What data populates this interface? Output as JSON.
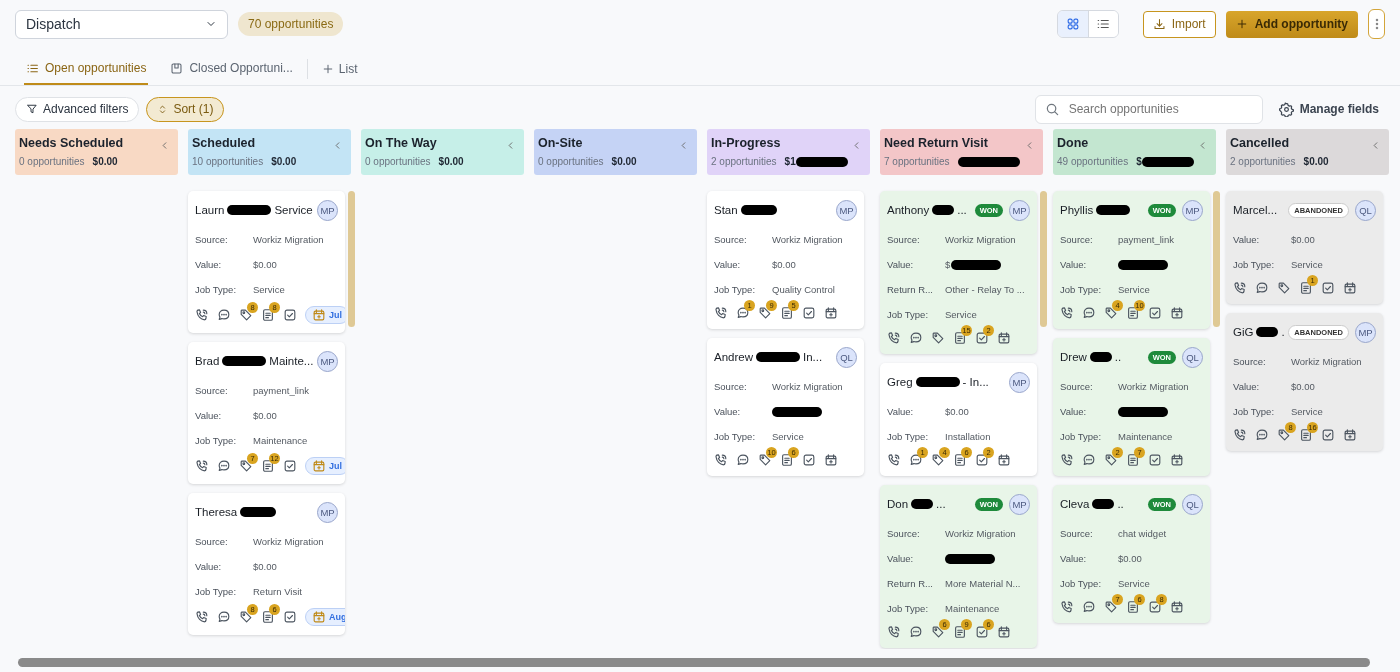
{
  "pipeline_select": {
    "value": "Dispatch"
  },
  "count_badge": "70 opportunities",
  "view_toggle": [
    {
      "kind": "grid",
      "selected": true
    },
    {
      "kind": "list",
      "selected": false
    }
  ],
  "import_button": "Import",
  "add_button": "Add opportunity",
  "tabs": [
    {
      "label": "Open opportunities",
      "kind": "list",
      "selected": true
    },
    {
      "label": "Closed Opportuni...",
      "kind": "board",
      "selected": false
    }
  ],
  "add_list": "List",
  "filters": {
    "advanced": "Advanced filters",
    "sort": "Sort (1)"
  },
  "search": {
    "placeholder": "Search opportunities"
  },
  "manage_fields": "Manage fields",
  "columns": [
    {
      "title": "Needs Scheduled",
      "count": "0 opportunities",
      "total": "$0.00",
      "color": "#f8d9c4"
    },
    {
      "title": "Scheduled",
      "count": "10 opportunities",
      "total": "$0.00",
      "color": "#c3e4f5",
      "cards": [
        {
          "name": "Laurn",
          "redacted": true,
          "name_end": "Service",
          "avatar": "MP",
          "fields": [
            {
              "label": "Source:",
              "value": "Workiz Migration"
            },
            {
              "label": "Value:",
              "value": "$0.00"
            },
            {
              "label": "Job Type:",
              "value": "Service"
            }
          ],
          "icons": [
            {
              "kind": "phone"
            },
            {
              "kind": "chat"
            },
            {
              "kind": "tag",
              "count": "8"
            },
            {
              "kind": "note",
              "count": "8"
            },
            {
              "kind": "task"
            }
          ],
          "date": "Jul"
        },
        {
          "name": "Brad",
          "redacted": true,
          "name_end": "Mainte...",
          "avatar": "MP",
          "fields": [
            {
              "label": "Source:",
              "value": "payment_link"
            },
            {
              "label": "Value:",
              "value": "$0.00"
            },
            {
              "label": "Job Type:",
              "value": "Maintenance"
            }
          ],
          "icons": [
            {
              "kind": "phone"
            },
            {
              "kind": "chat"
            },
            {
              "kind": "tag",
              "count": "7"
            },
            {
              "kind": "note",
              "count": "12"
            },
            {
              "kind": "task"
            }
          ],
          "date": "Jul"
        },
        {
          "name": "Theresa",
          "redacted": true,
          "avatar": "MP",
          "fields": [
            {
              "label": "Source:",
              "value": "Workiz Migration"
            },
            {
              "label": "Value:",
              "value": "$0.00"
            },
            {
              "label": "Job Type:",
              "value": "Return Visit"
            }
          ],
          "icons": [
            {
              "kind": "phone"
            },
            {
              "kind": "chat"
            },
            {
              "kind": "tag",
              "count": "8"
            },
            {
              "kind": "note",
              "count": "6"
            },
            {
              "kind": "task"
            }
          ],
          "date": "Aug"
        }
      ]
    },
    {
      "title": "On The Way",
      "count": "0 opportunities",
      "total": "$0.00",
      "color": "#c6efe8"
    },
    {
      "title": "On-Site",
      "count": "0 opportunities",
      "total": "$0.00",
      "color": "#c5d3f5"
    },
    {
      "title": "In-Progress",
      "count": "2 opportunities",
      "total": "$1",
      "redacted": true,
      "color": "#e0d3f8",
      "cards": [
        {
          "name": "Stan",
          "redacted": true,
          "avatar": "MP",
          "fields": [
            {
              "label": "Source:",
              "value": "Workiz Migration"
            },
            {
              "label": "Value:",
              "value": "$0.00"
            },
            {
              "label": "Job Type:",
              "value": "Quality Control"
            }
          ],
          "icons": [
            {
              "kind": "phone"
            },
            {
              "kind": "chat",
              "count": "1"
            },
            {
              "kind": "tag",
              "count": "9"
            },
            {
              "kind": "note",
              "count": "5"
            },
            {
              "kind": "task"
            },
            {
              "kind": "calendar"
            }
          ]
        },
        {
          "name": "Andrew",
          "redacted": true,
          "name_end": "In...",
          "avatar": "QL",
          "fields": [
            {
              "label": "Source:",
              "value": "Workiz Migration"
            },
            {
              "label": "Value:",
              "redacted": true
            },
            {
              "label": "Job Type:",
              "value": "Service"
            }
          ],
          "icons": [
            {
              "kind": "phone"
            },
            {
              "kind": "chat"
            },
            {
              "kind": "tag",
              "count": "10"
            },
            {
              "kind": "note",
              "count": "6"
            },
            {
              "kind": "task"
            },
            {
              "kind": "calendar"
            }
          ]
        }
      ]
    },
    {
      "title": "Need Return Visit",
      "count": "7 opportunities",
      "redacted": true,
      "color": "#f3c6c8",
      "cards": [
        {
          "name": "Anthony",
          "redacted": true,
          "name_end": "...",
          "status": {
            "label": "WON",
            "kind": "won"
          },
          "avatar": "MP",
          "fields": [
            {
              "label": "Source:",
              "value": "Workiz Migration"
            },
            {
              "label": "Value:",
              "value": "$",
              "redacted": true
            },
            {
              "label": "Return R...",
              "value": "Other - Relay To ..."
            },
            {
              "label": "Job Type:",
              "value": "Service"
            }
          ],
          "icons": [
            {
              "kind": "phone"
            },
            {
              "kind": "chat"
            },
            {
              "kind": "tag"
            },
            {
              "kind": "note",
              "count": "15"
            },
            {
              "kind": "task",
              "count": "2"
            },
            {
              "kind": "calendar"
            }
          ]
        },
        {
          "name": "Greg",
          "redacted": true,
          "name_end": "- In...",
          "avatar": "MP",
          "fields": [
            {
              "label": "Value:",
              "value": "$0.00"
            },
            {
              "label": "Job Type:",
              "value": "Installation"
            }
          ],
          "icons": [
            {
              "kind": "phone"
            },
            {
              "kind": "chat",
              "count": "1"
            },
            {
              "kind": "tag",
              "count": "4"
            },
            {
              "kind": "note",
              "count": "6"
            },
            {
              "kind": "task",
              "count": "2"
            },
            {
              "kind": "calendar"
            }
          ]
        },
        {
          "name": "Don",
          "redacted": true,
          "name_end": "...",
          "status": {
            "label": "WON",
            "kind": "won"
          },
          "avatar": "MP",
          "fields": [
            {
              "label": "Source:",
              "value": "Workiz Migration"
            },
            {
              "label": "Value:",
              "redacted": true
            },
            {
              "label": "Return R...",
              "value": "More Material N..."
            },
            {
              "label": "Job Type:",
              "value": "Maintenance"
            }
          ],
          "icons": [
            {
              "kind": "phone"
            },
            {
              "kind": "chat"
            },
            {
              "kind": "tag",
              "count": "6"
            },
            {
              "kind": "note",
              "count": "9"
            },
            {
              "kind": "task",
              "count": "6"
            },
            {
              "kind": "calendar"
            }
          ]
        }
      ]
    },
    {
      "title": "Done",
      "count": "49 opportunities",
      "total": "$",
      "redacted": true,
      "color": "#c3e6d0",
      "cards": [
        {
          "name": "Phyllis",
          "redacted": true,
          "status": {
            "label": "WON",
            "kind": "won"
          },
          "avatar": "MP",
          "fields": [
            {
              "label": "Source:",
              "value": "payment_link"
            },
            {
              "label": "Value:",
              "redacted": true
            },
            {
              "label": "Job Type:",
              "value": "Service"
            }
          ],
          "icons": [
            {
              "kind": "phone"
            },
            {
              "kind": "chat"
            },
            {
              "kind": "tag",
              "count": "4"
            },
            {
              "kind": "note",
              "count": "10"
            },
            {
              "kind": "task"
            },
            {
              "kind": "calendar"
            }
          ]
        },
        {
          "name": "Drew",
          "redacted": true,
          "name_end": "..",
          "status": {
            "label": "WON",
            "kind": "won"
          },
          "avatar": "QL",
          "fields": [
            {
              "label": "Source:",
              "value": "Workiz Migration"
            },
            {
              "label": "Value:",
              "redacted": true
            },
            {
              "label": "Job Type:",
              "value": "Maintenance"
            }
          ],
          "icons": [
            {
              "kind": "phone"
            },
            {
              "kind": "chat"
            },
            {
              "kind": "tag",
              "count": "2"
            },
            {
              "kind": "note",
              "count": "7"
            },
            {
              "kind": "task"
            },
            {
              "kind": "calendar"
            }
          ]
        },
        {
          "name": "Cleva",
          "redacted": true,
          "name_end": "..",
          "status": {
            "label": "WON",
            "kind": "won"
          },
          "avatar": "QL",
          "fields": [
            {
              "label": "Source:",
              "value": "chat widget"
            },
            {
              "label": "Value:",
              "value": "$0.00"
            },
            {
              "label": "Job Type:",
              "value": "Service"
            }
          ],
          "icons": [
            {
              "kind": "phone"
            },
            {
              "kind": "chat"
            },
            {
              "kind": "tag",
              "count": "7"
            },
            {
              "kind": "note",
              "count": "6"
            },
            {
              "kind": "task",
              "count": "8"
            },
            {
              "kind": "calendar"
            }
          ]
        }
      ]
    },
    {
      "title": "Cancelled",
      "count": "2 opportunities",
      "total": "$0.00",
      "color": "#dcd9da",
      "cards": [
        {
          "name": "Marcel...",
          "status": {
            "label": "ABANDONED",
            "kind": "abandoned"
          },
          "avatar": "QL",
          "fields": [
            {
              "label": "Value:",
              "value": "$0.00"
            },
            {
              "label": "Job Type:",
              "value": "Service"
            }
          ],
          "icons": [
            {
              "kind": "phone"
            },
            {
              "kind": "chat"
            },
            {
              "kind": "tag"
            },
            {
              "kind": "note",
              "count": "1"
            },
            {
              "kind": "task"
            },
            {
              "kind": "calendar"
            }
          ]
        },
        {
          "name": "GiG",
          "redacted": true,
          "name_end": ".",
          "status": {
            "label": "ABANDONED",
            "kind": "abandoned"
          },
          "avatar": "MP",
          "fields": [
            {
              "label": "Source:",
              "value": "Workiz Migration"
            },
            {
              "label": "Value:",
              "value": "$0.00"
            },
            {
              "label": "Job Type:",
              "value": "Service"
            }
          ],
          "icons": [
            {
              "kind": "phone"
            },
            {
              "kind": "chat"
            },
            {
              "kind": "tag",
              "count": "8"
            },
            {
              "kind": "note",
              "count": "16"
            },
            {
              "kind": "task"
            },
            {
              "kind": "calendar"
            }
          ]
        }
      ]
    }
  ]
}
